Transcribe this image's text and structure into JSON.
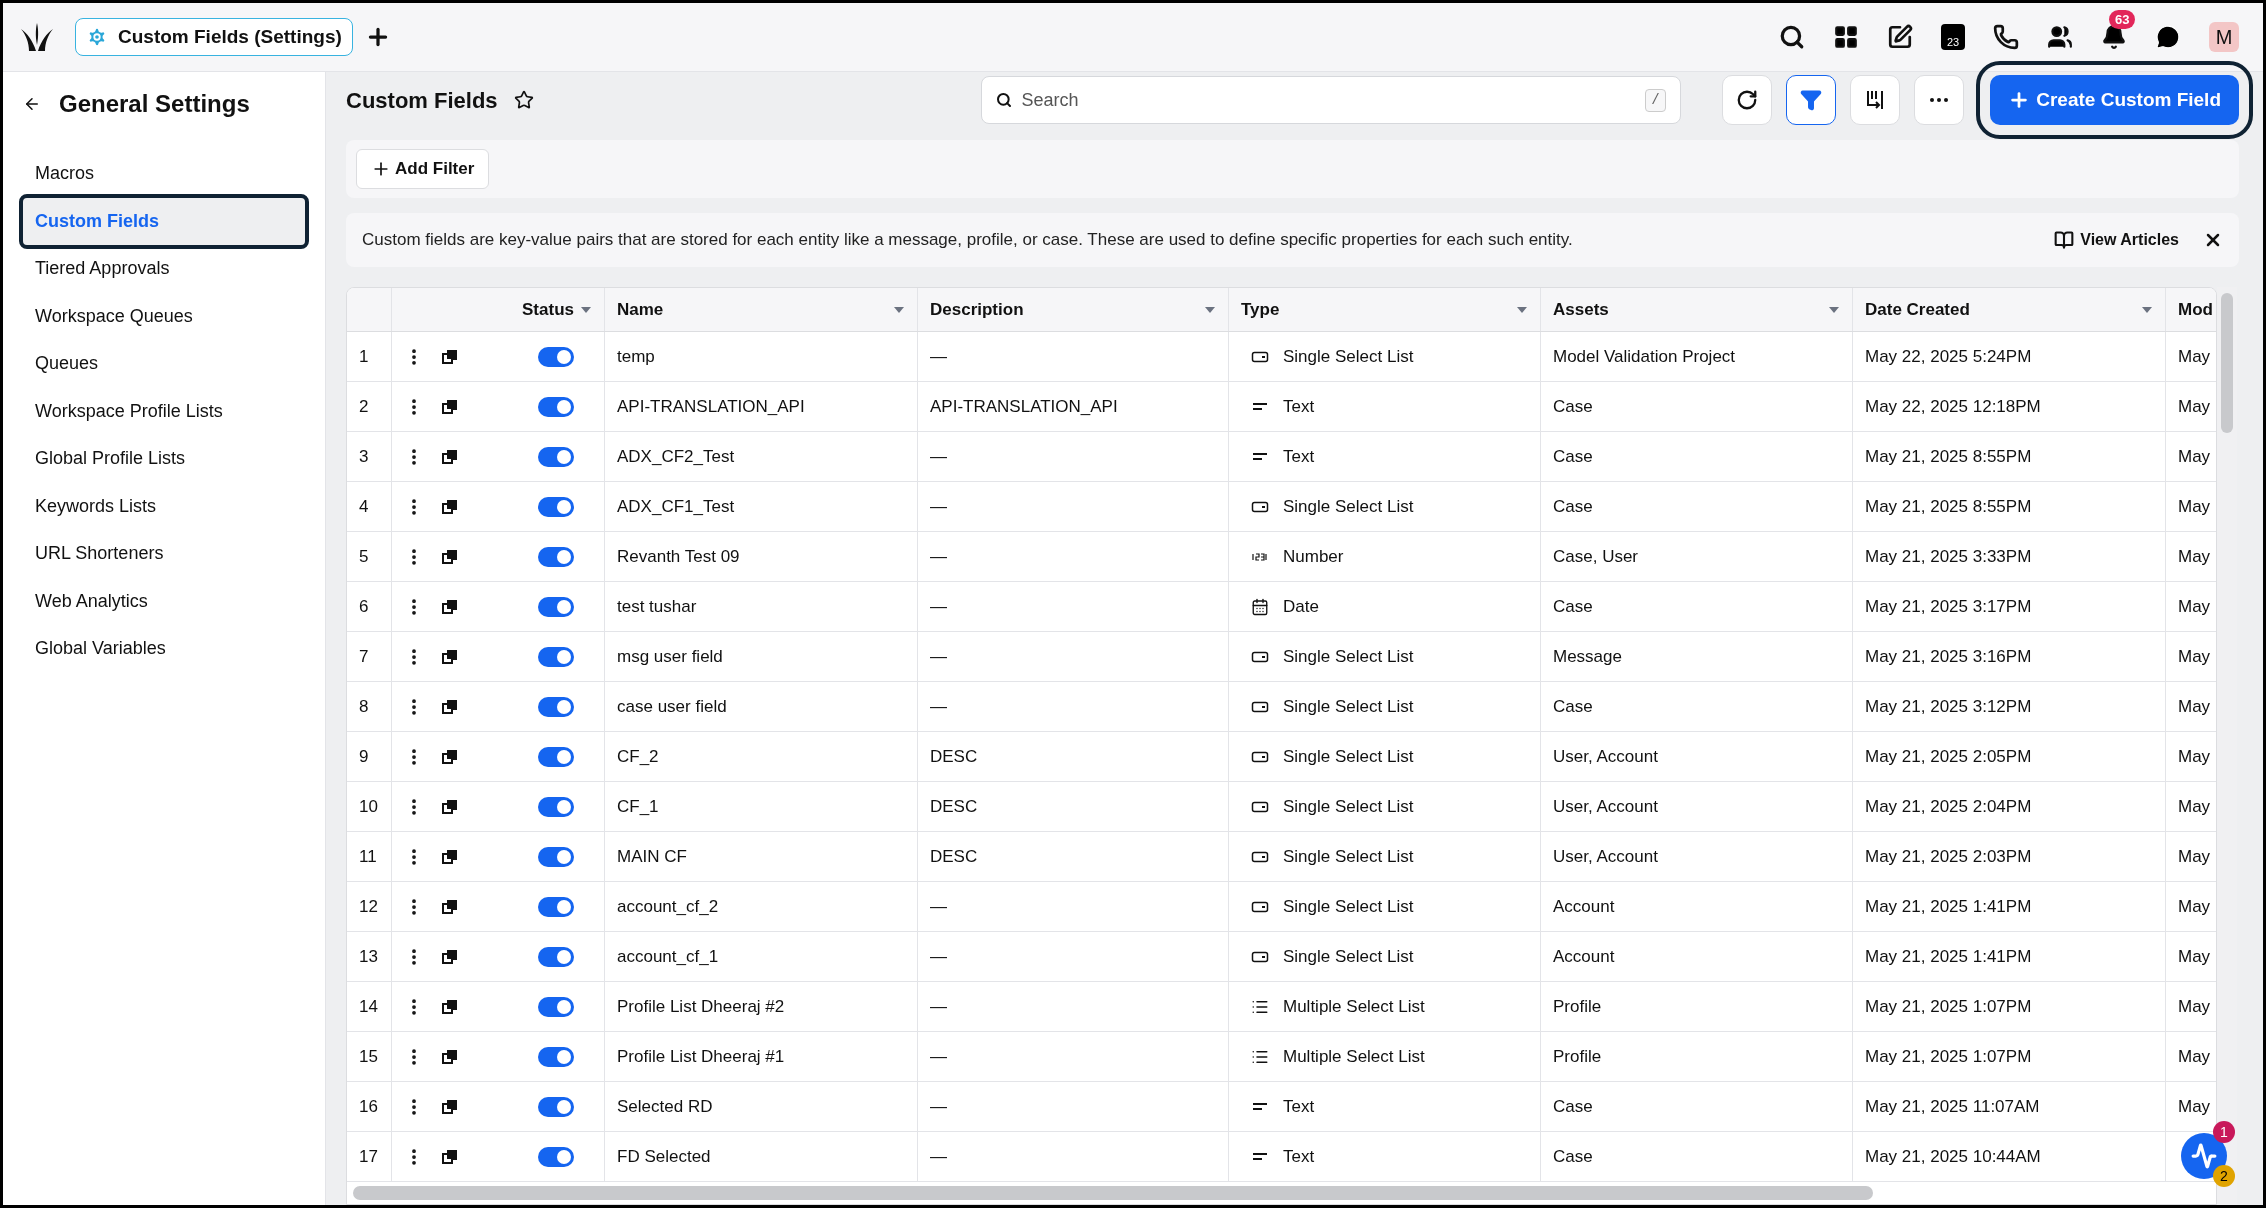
{
  "top_bar": {
    "tab": {
      "label": "Custom Fields (Settings)",
      "selected": true
    },
    "calendar_day": "23",
    "notification_count": "63",
    "avatar_initial": "M"
  },
  "sidebar": {
    "title": "General Settings",
    "items": [
      {
        "label": "Macros",
        "selected": false
      },
      {
        "label": "Custom Fields",
        "selected": true
      },
      {
        "label": "Tiered Approvals",
        "selected": false
      },
      {
        "label": "Workspace Queues",
        "selected": false
      },
      {
        "label": "Queues",
        "selected": false
      },
      {
        "label": "Workspace Profile Lists",
        "selected": false
      },
      {
        "label": "Global Profile Lists",
        "selected": false
      },
      {
        "label": "Keywords Lists",
        "selected": false
      },
      {
        "label": "URL Shorteners",
        "selected": false
      },
      {
        "label": "Web Analytics",
        "selected": false
      },
      {
        "label": "Global Variables",
        "selected": false
      }
    ]
  },
  "header": {
    "title": "Custom Fields",
    "search": {
      "placeholder": "Search",
      "shortcut": "/"
    },
    "filter_active": true,
    "create_button": "Create Custom Field"
  },
  "filter_bar": {
    "add_filter": "Add Filter"
  },
  "banner": {
    "text": "Custom fields are key-value pairs that are stored for each entity like a message, profile, or case. These are used to define specific properties for each such entity.",
    "link": "View Articles"
  },
  "table": {
    "columns": [
      "Status",
      "Name",
      "Description",
      "Type",
      "Assets",
      "Date Created",
      "Mod"
    ],
    "rows": [
      {
        "index": "1",
        "on": true,
        "name": "temp",
        "description": "—",
        "type": {
          "kind": "select",
          "label": "Single Select List"
        },
        "assets": "Model Validation Project",
        "date_created": "May 22, 2025 5:24PM",
        "column_7": "May"
      },
      {
        "index": "2",
        "on": true,
        "name": "API-TRANSLATION_API",
        "description": "API-TRANSLATION_API",
        "type": {
          "kind": "text",
          "label": "Text"
        },
        "assets": "Case",
        "date_created": "May 22, 2025 12:18PM",
        "column_7": "May"
      },
      {
        "index": "3",
        "on": true,
        "name": "ADX_CF2_Test",
        "description": "—",
        "type": {
          "kind": "text",
          "label": "Text"
        },
        "assets": "Case",
        "date_created": "May 21, 2025 8:55PM",
        "column_7": "May"
      },
      {
        "index": "4",
        "on": true,
        "name": "ADX_CF1_Test",
        "description": "—",
        "type": {
          "kind": "select",
          "label": "Single Select List"
        },
        "assets": "Case",
        "date_created": "May 21, 2025 8:55PM",
        "column_7": "May"
      },
      {
        "index": "5",
        "on": true,
        "name": "Revanth Test 09",
        "description": "—",
        "type": {
          "kind": "number",
          "label": "Number"
        },
        "assets": "Case, User",
        "date_created": "May 21, 2025 3:33PM",
        "column_7": "May"
      },
      {
        "index": "6",
        "on": true,
        "name": "test tushar",
        "description": "—",
        "type": {
          "kind": "date",
          "label": "Date"
        },
        "assets": "Case",
        "date_created": "May 21, 2025 3:17PM",
        "column_7": "May"
      },
      {
        "index": "7",
        "on": true,
        "name": "msg user field",
        "description": "—",
        "type": {
          "kind": "select",
          "label": "Single Select List"
        },
        "assets": "Message",
        "date_created": "May 21, 2025 3:16PM",
        "column_7": "May"
      },
      {
        "index": "8",
        "on": true,
        "name": "case user field",
        "description": "—",
        "type": {
          "kind": "select",
          "label": "Single Select List"
        },
        "assets": "Case",
        "date_created": "May 21, 2025 3:12PM",
        "column_7": "May"
      },
      {
        "index": "9",
        "on": true,
        "name": "CF_2",
        "description": "DESC",
        "type": {
          "kind": "select",
          "label": "Single Select List"
        },
        "assets": "User, Account",
        "date_created": "May 21, 2025 2:05PM",
        "column_7": "May"
      },
      {
        "index": "10",
        "on": true,
        "name": "CF_1",
        "description": "DESC",
        "type": {
          "kind": "select",
          "label": "Single Select List"
        },
        "assets": "User, Account",
        "date_created": "May 21, 2025 2:04PM",
        "column_7": "May"
      },
      {
        "index": "11",
        "on": true,
        "name": "MAIN CF",
        "description": "DESC",
        "type": {
          "kind": "select",
          "label": "Single Select List"
        },
        "assets": "User, Account",
        "date_created": "May 21, 2025 2:03PM",
        "column_7": "May"
      },
      {
        "index": "12",
        "on": true,
        "name": "account_cf_2",
        "description": "—",
        "type": {
          "kind": "select",
          "label": "Single Select List"
        },
        "assets": "Account",
        "date_created": "May 21, 2025 1:41PM",
        "column_7": "May"
      },
      {
        "index": "13",
        "on": true,
        "name": "account_cf_1",
        "description": "—",
        "type": {
          "kind": "select",
          "label": "Single Select List"
        },
        "assets": "Account",
        "date_created": "May 21, 2025 1:41PM",
        "column_7": "May"
      },
      {
        "index": "14",
        "on": true,
        "name": "Profile List Dheeraj #2",
        "description": "—",
        "type": {
          "kind": "multi",
          "label": "Multiple Select List"
        },
        "assets": "Profile",
        "date_created": "May 21, 2025 1:07PM",
        "column_7": "May"
      },
      {
        "index": "15",
        "on": true,
        "name": "Profile List Dheeraj #1",
        "description": "—",
        "type": {
          "kind": "multi",
          "label": "Multiple Select List"
        },
        "assets": "Profile",
        "date_created": "May 21, 2025 1:07PM",
        "column_7": "May"
      },
      {
        "index": "16",
        "on": true,
        "name": "Selected RD",
        "description": "—",
        "type": {
          "kind": "text",
          "label": "Text"
        },
        "assets": "Case",
        "date_created": "May 21, 2025 11:07AM",
        "column_7": "May"
      },
      {
        "index": "17",
        "on": true,
        "name": "FD Selected",
        "description": "—",
        "type": {
          "kind": "text",
          "label": "Text"
        },
        "assets": "Case",
        "date_created": "May 21, 2025 10:44AM"
      }
    ]
  },
  "floating_button": {
    "badge_red": "1",
    "badge_yellow": "2"
  }
}
